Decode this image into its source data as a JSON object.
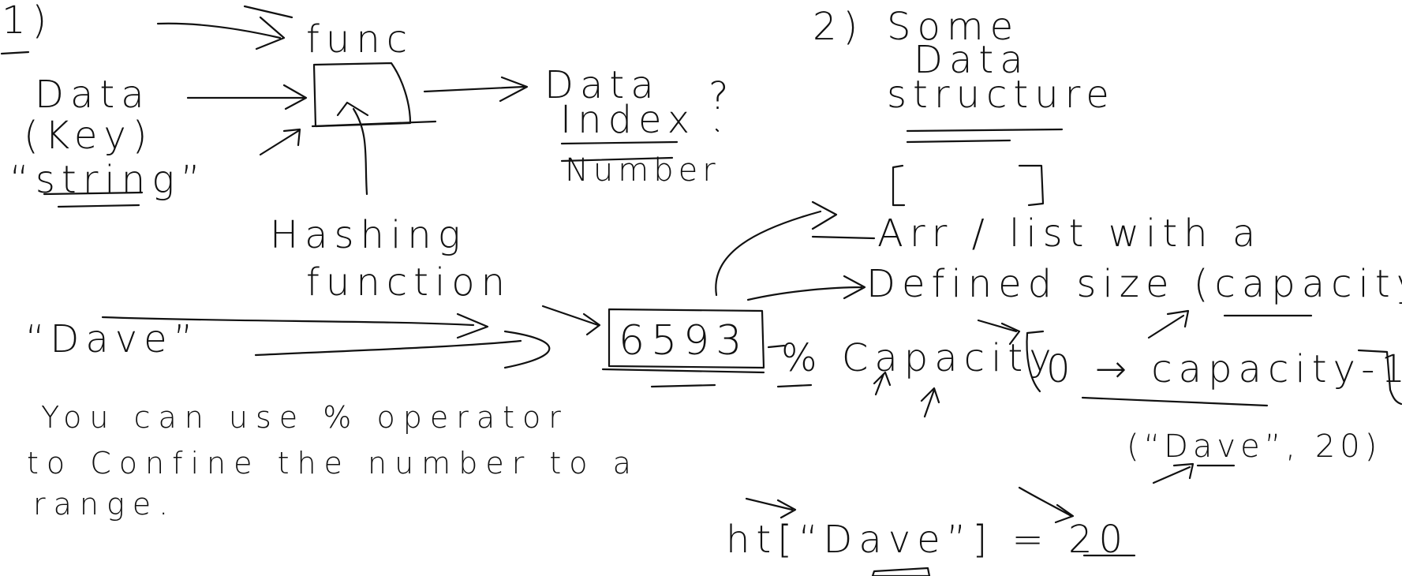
{
  "colors": {
    "ink": "#111111",
    "background": "#ffffff"
  },
  "section1": {
    "number": "1)",
    "func": "func",
    "data": "Data",
    "key": "(Key)",
    "string": "“string”",
    "data_index": "Data",
    "index": "Index",
    "question": "?",
    "number_label": "Number",
    "hashing_1": "Hashing",
    "hashing_2": "function"
  },
  "section2": {
    "number": "2)",
    "title_1": "Some",
    "title_2": "Data",
    "title_3": "structure",
    "bracket_box": "[     ]",
    "arr_list": "Arr / list with a",
    "defined": "Defined size (capacity)"
  },
  "flow": {
    "dave": "“Dave”",
    "hash_value": "6593",
    "mod_capacity": "% Capacity",
    "range_open": "[",
    "range_body": "0 → capacity-1",
    "range_close": "]",
    "pair": "(“Dave”, 20)",
    "assignment": "ht[“Dave”] = 20"
  },
  "note": {
    "line1": "You can use % operator",
    "line2": "to Confine the number to a",
    "line3": "range."
  }
}
